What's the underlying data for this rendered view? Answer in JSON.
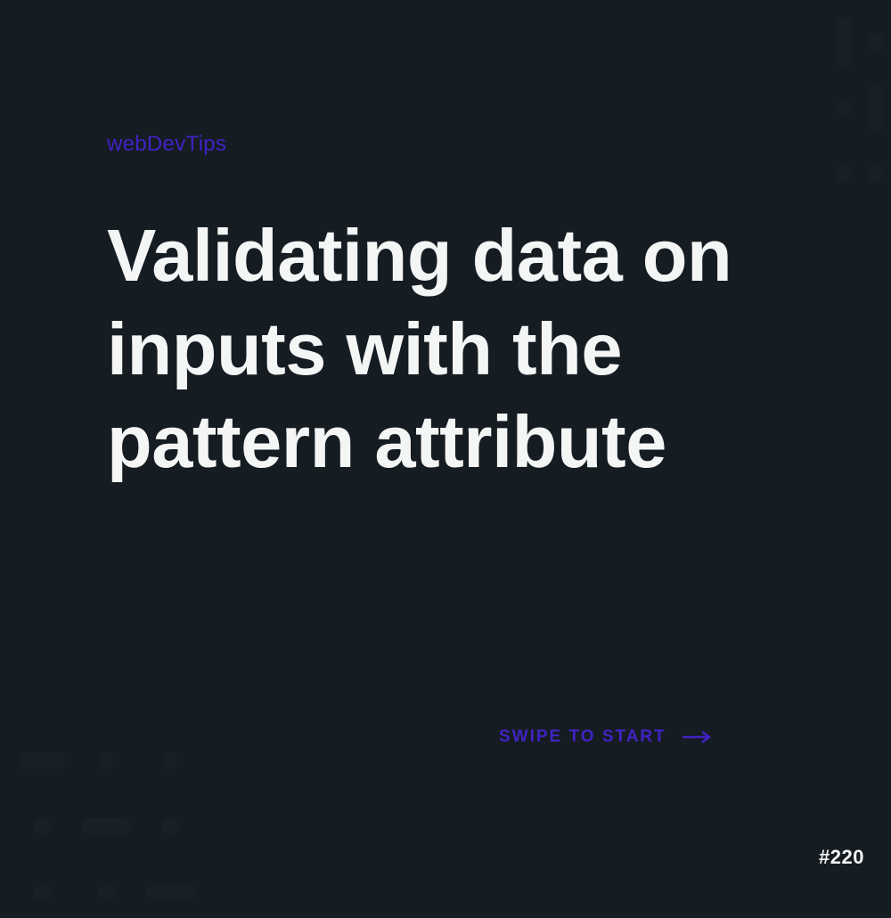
{
  "brand": "webDevTips",
  "title": "Validating data on inputs with the pattern attribute",
  "cta": "SWIPE TO START",
  "slide_number": "#220",
  "colors": {
    "background": "#151c22",
    "accent": "#4122c4",
    "text": "#f4f6f6"
  }
}
